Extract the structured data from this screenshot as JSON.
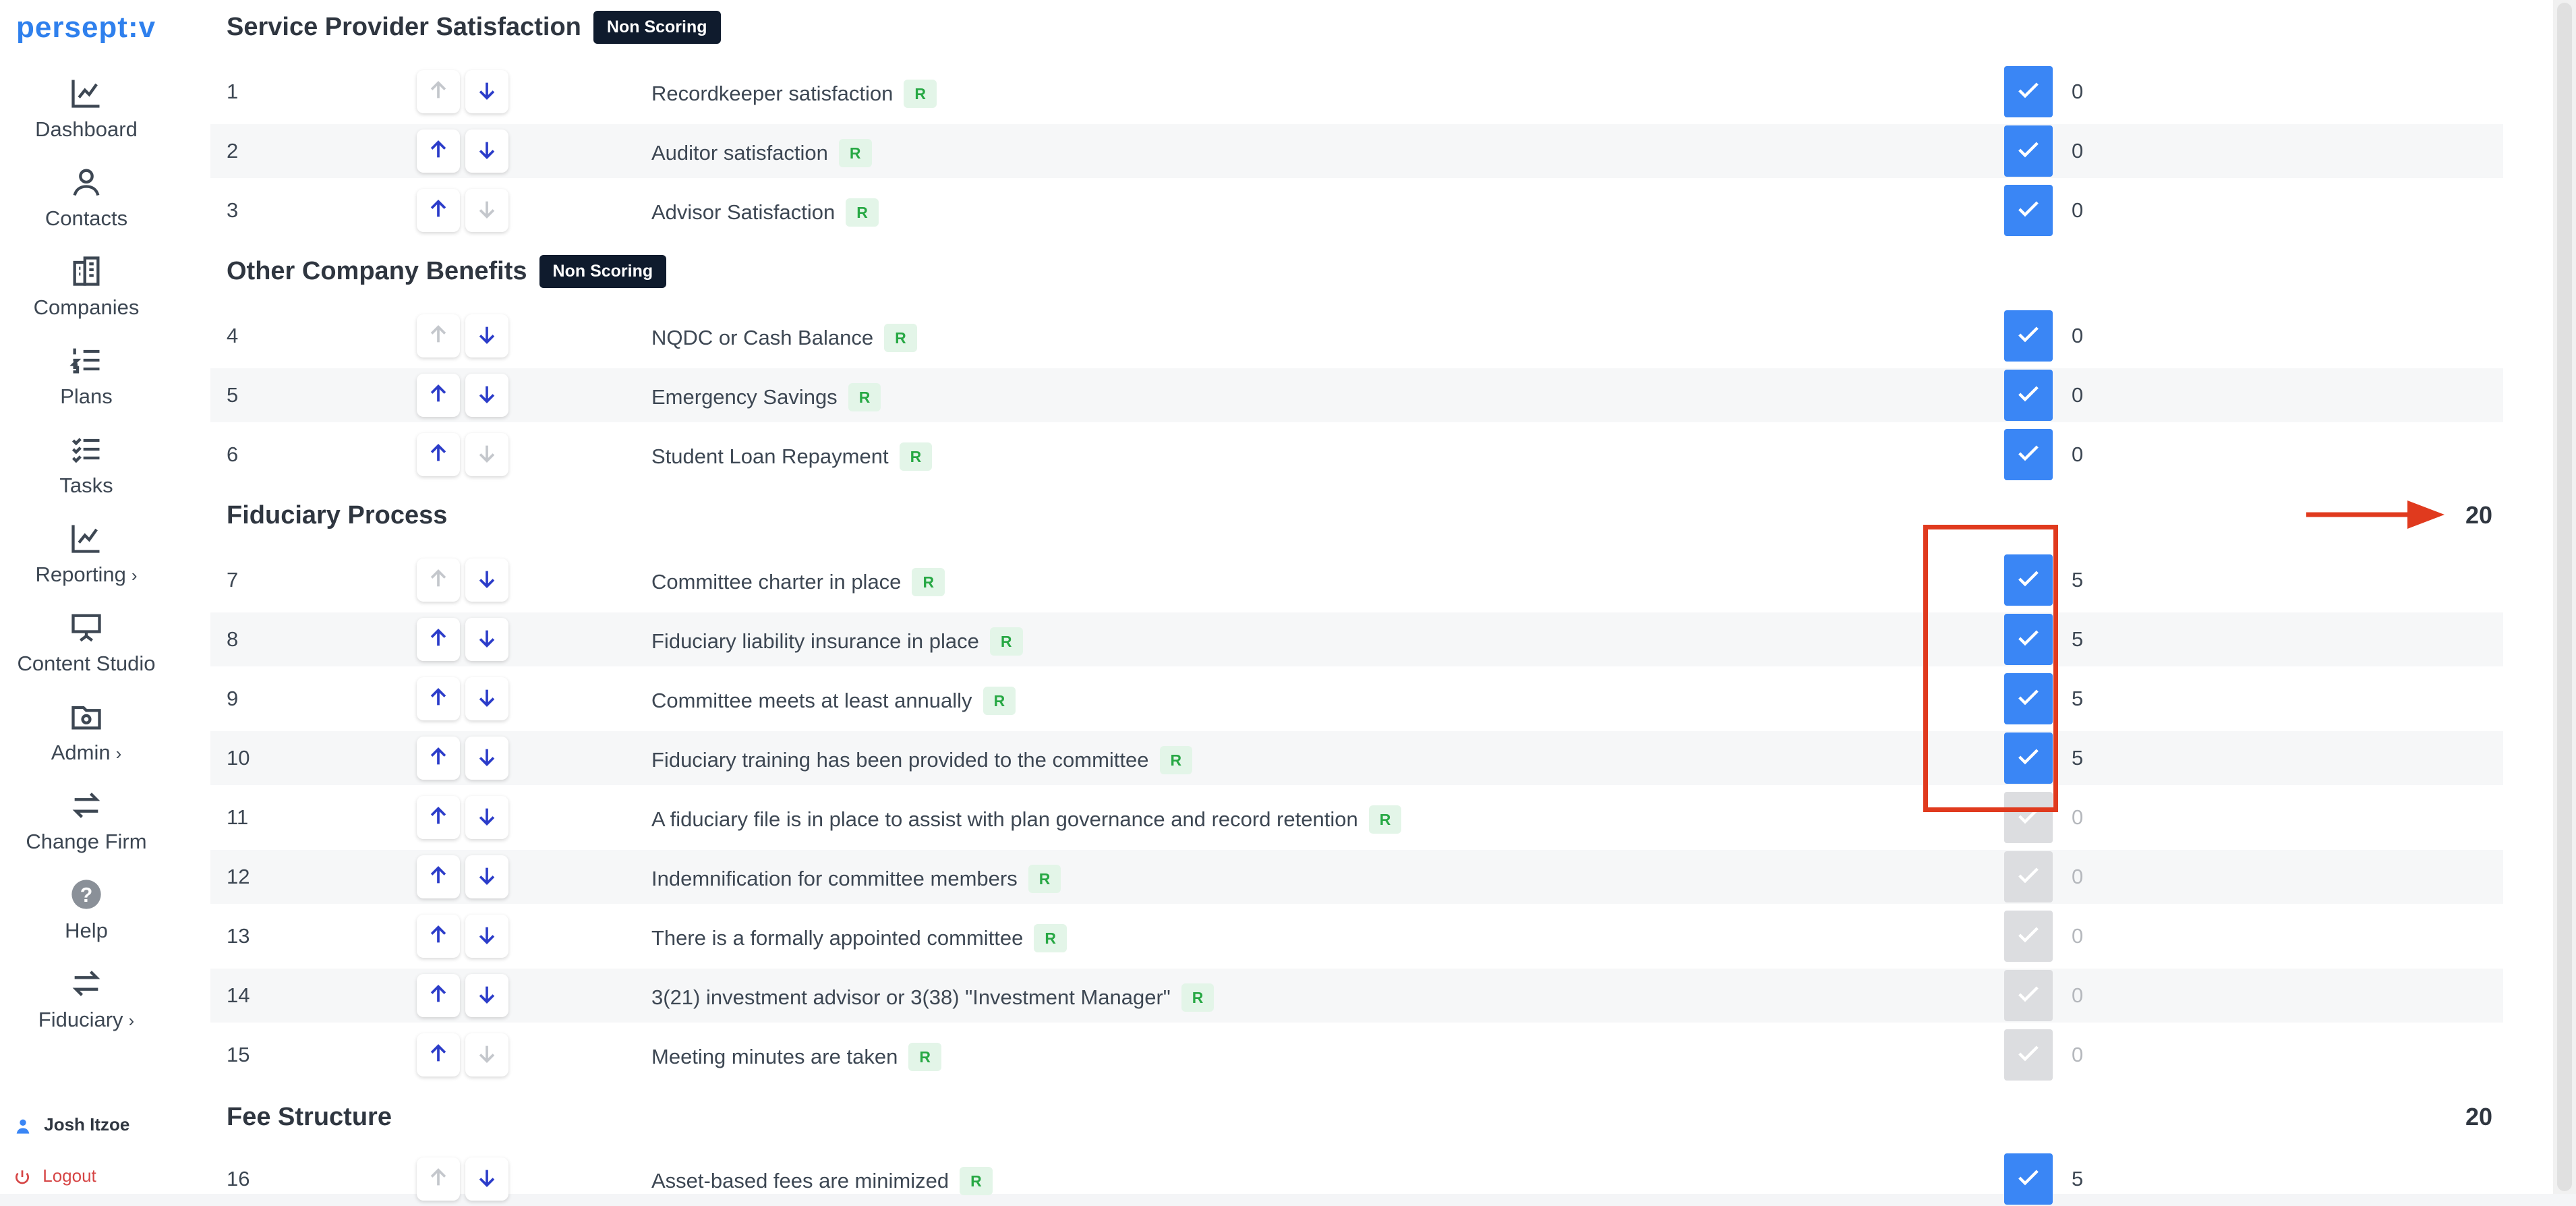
{
  "app": {
    "logo": "persept:v"
  },
  "sidebar": {
    "items": [
      {
        "label": "Dashboard",
        "icon": "chart-line-icon"
      },
      {
        "label": "Contacts",
        "icon": "user-icon"
      },
      {
        "label": "Companies",
        "icon": "building-icon"
      },
      {
        "label": "Plans",
        "icon": "numbered-list-icon"
      },
      {
        "label": "Tasks",
        "icon": "checklist-icon"
      },
      {
        "label": "Reporting",
        "icon": "chart-line-icon",
        "chevron": "›"
      },
      {
        "label": "Content Studio",
        "icon": "presentation-icon"
      },
      {
        "label": "Admin",
        "icon": "folder-gear-icon",
        "chevron": "›"
      },
      {
        "label": "Change Firm",
        "icon": "swap-arrows-icon"
      },
      {
        "label": "Help",
        "icon": "question-circle-icon"
      },
      {
        "label": "Fiduciary",
        "icon": "swap-arrows-icon",
        "chevron": "›"
      }
    ],
    "user": "Josh Itzoe",
    "logout": "Logout"
  },
  "badges": {
    "non_scoring": "Non Scoring",
    "required": "R"
  },
  "sections": [
    {
      "title": "Service Provider Satisfaction",
      "non_scoring": true,
      "total": "",
      "rows": [
        {
          "num": "1",
          "label": "Recordkeeper satisfaction",
          "checked": true,
          "score": "0",
          "up_enabled": false,
          "down_enabled": true
        },
        {
          "num": "2",
          "label": "Auditor satisfaction",
          "checked": true,
          "score": "0",
          "up_enabled": true,
          "down_enabled": true
        },
        {
          "num": "3",
          "label": "Advisor Satisfaction",
          "checked": true,
          "score": "0",
          "up_enabled": true,
          "down_enabled": false
        }
      ]
    },
    {
      "title": "Other Company Benefits",
      "non_scoring": true,
      "total": "",
      "rows": [
        {
          "num": "4",
          "label": "NQDC or Cash Balance",
          "checked": true,
          "score": "0",
          "up_enabled": false,
          "down_enabled": true
        },
        {
          "num": "5",
          "label": "Emergency Savings",
          "checked": true,
          "score": "0",
          "up_enabled": true,
          "down_enabled": true
        },
        {
          "num": "6",
          "label": "Student Loan Repayment",
          "checked": true,
          "score": "0",
          "up_enabled": true,
          "down_enabled": false
        }
      ]
    },
    {
      "title": "Fiduciary Process",
      "non_scoring": false,
      "total": "20",
      "rows": [
        {
          "num": "7",
          "label": "Committee charter in place",
          "checked": true,
          "score": "5",
          "up_enabled": false,
          "down_enabled": true
        },
        {
          "num": "8",
          "label": "Fiduciary liability insurance in place",
          "checked": true,
          "score": "5",
          "up_enabled": true,
          "down_enabled": true
        },
        {
          "num": "9",
          "label": "Committee meets at least annually",
          "checked": true,
          "score": "5",
          "up_enabled": true,
          "down_enabled": true
        },
        {
          "num": "10",
          "label": "Fiduciary training has been provided to the committee",
          "checked": true,
          "score": "5",
          "up_enabled": true,
          "down_enabled": true
        },
        {
          "num": "11",
          "label": "A fiduciary file is in place to assist with plan governance and record retention",
          "checked": false,
          "score": "0",
          "up_enabled": true,
          "down_enabled": true
        },
        {
          "num": "12",
          "label": "Indemnification for committee members",
          "checked": false,
          "score": "0",
          "up_enabled": true,
          "down_enabled": true
        },
        {
          "num": "13",
          "label": "There is a formally appointed committee",
          "checked": false,
          "score": "0",
          "up_enabled": true,
          "down_enabled": true
        },
        {
          "num": "14",
          "label": "3(21) investment advisor or 3(38) \"Investment Manager\"",
          "checked": false,
          "score": "0",
          "up_enabled": true,
          "down_enabled": true
        },
        {
          "num": "15",
          "label": "Meeting minutes are taken",
          "checked": false,
          "score": "0",
          "up_enabled": true,
          "down_enabled": false
        }
      ]
    },
    {
      "title": "Fee Structure",
      "non_scoring": false,
      "total": "20",
      "rows": [
        {
          "num": "16",
          "label": "Asset-based fees are minimized",
          "checked": true,
          "score": "5",
          "up_enabled": false,
          "down_enabled": true
        }
      ]
    }
  ],
  "colors": {
    "accent": "#3a86f5",
    "annotation": "#e03a1e",
    "badge_dark": "#0f1b2d",
    "badge_green": "#27a844"
  }
}
